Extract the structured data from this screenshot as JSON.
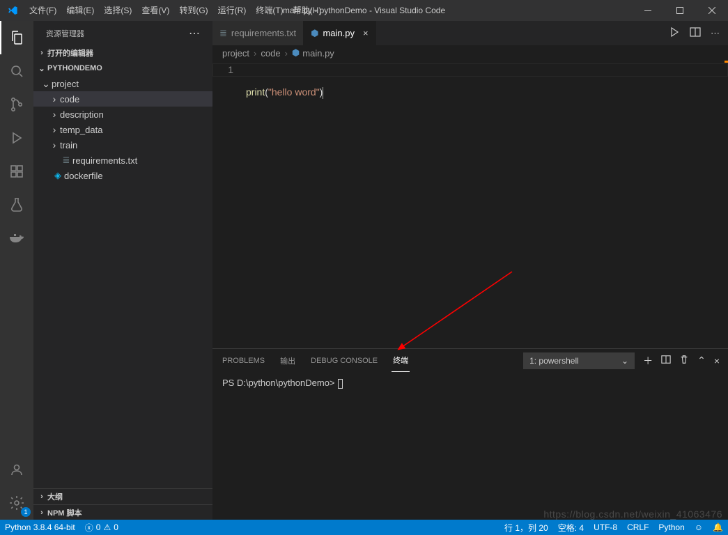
{
  "menu": {
    "file": "文件(F)",
    "edit": "编辑(E)",
    "select": "选择(S)",
    "view": "查看(V)",
    "go": "转到(G)",
    "run": "运行(R)",
    "terminal": "终端(T)",
    "help": "帮助(H)"
  },
  "window_title": "main.py - pythonDemo - Visual Studio Code",
  "sidebar": {
    "title": "资源管理器",
    "open_editors": "打开的编辑器",
    "project_root": "PYTHONDEMO",
    "tree": {
      "project": "project",
      "code": "code",
      "description": "description",
      "temp_data": "temp_data",
      "train": "train",
      "requirements": "requirements.txt",
      "dockerfile": "dockerfile"
    },
    "outline": "大纲",
    "npm": "NPM 脚本"
  },
  "tabs": {
    "requirements": "requirements.txt",
    "main": "main.py"
  },
  "breadcrumbs": {
    "project": "project",
    "code": "code",
    "main": "main.py"
  },
  "code": {
    "line1_no": "1",
    "print": "print",
    "open": "(",
    "string": "\"hello word\"",
    "close": ")"
  },
  "panel": {
    "problems": "PROBLEMS",
    "output": "输出",
    "debug_console": "DEBUG CONSOLE",
    "terminal": "终端",
    "selector": "1: powershell",
    "prompt": "PS D:\\python\\pythonDemo>"
  },
  "statusbar": {
    "python": "Python 3.8.4 64-bit",
    "errors": "0",
    "warnings": "0",
    "ln_col": "行 1，列 20",
    "spaces": "空格: 4",
    "encoding": "UTF-8",
    "eol": "CRLF",
    "lang": "Python"
  },
  "watermark": "https://blog.csdn.net/weixin_41063476",
  "settings_badge": "1"
}
